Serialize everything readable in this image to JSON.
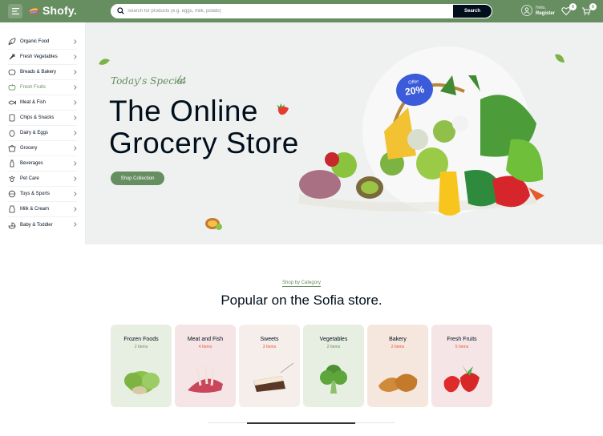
{
  "header": {
    "logo_text": "Shofy.",
    "search_placeholder": "Search for products (e.g. eggs, milk, potato)",
    "search_button": "Search",
    "user_hello": "Hello,",
    "user_register": "Register",
    "wishlist_count": "0",
    "cart_count": "0",
    "brand_color": "#678e61"
  },
  "sidebar": {
    "items": [
      {
        "label": "Organic Food",
        "icon": "leaf-icon"
      },
      {
        "label": "Fresh Vegetables",
        "icon": "carrot-icon"
      },
      {
        "label": "Breads & Bakery",
        "icon": "bread-icon"
      },
      {
        "label": "Fresh Fruits",
        "icon": "apple-icon"
      },
      {
        "label": "Meat & Fish",
        "icon": "fish-icon"
      },
      {
        "label": "Chips & Snacks",
        "icon": "chips-icon"
      },
      {
        "label": "Dairy & Eggs",
        "icon": "egg-icon"
      },
      {
        "label": "Grocery",
        "icon": "grocery-icon"
      },
      {
        "label": "Beverages",
        "icon": "bottle-icon"
      },
      {
        "label": "Pet Care",
        "icon": "paw-icon"
      },
      {
        "label": "Toys & Sports",
        "icon": "ball-icon"
      },
      {
        "label": "Milk & Cream",
        "icon": "milk-icon"
      },
      {
        "label": "Baby & Toddler",
        "icon": "baby-icon"
      }
    ],
    "active_index": 3
  },
  "hero": {
    "subtitle": "Today's Special",
    "title_line1": "The Online",
    "title_line2": "Grocery Store",
    "button": "Shop Collection",
    "offer_label": "Offer",
    "offer_value": "20%"
  },
  "section": {
    "subtitle": "Shop by Category",
    "title": "Popular on the Sofia store."
  },
  "categories": [
    {
      "name": "Frozen Foods",
      "count": "2 Items",
      "bg": "#e7efe3",
      "count_color": "#678e61"
    },
    {
      "name": "Meat and Fish",
      "count": "4 Items",
      "bg": "#f6e5e7",
      "count_color": "#e9573f"
    },
    {
      "name": "Sweets",
      "count": "3 Items",
      "bg": "#f6eeea",
      "count_color": "#e9573f"
    },
    {
      "name": "Vegetables",
      "count": "2 Items",
      "bg": "#e7efe3",
      "count_color": "#678e61"
    },
    {
      "name": "Bakery",
      "count": "2 Items",
      "bg": "#f6e7de",
      "count_color": "#e9573f"
    },
    {
      "name": "Fresh Fruits",
      "count": "5 Items",
      "bg": "#f6e5e7",
      "count_color": "#e9573f"
    }
  ]
}
